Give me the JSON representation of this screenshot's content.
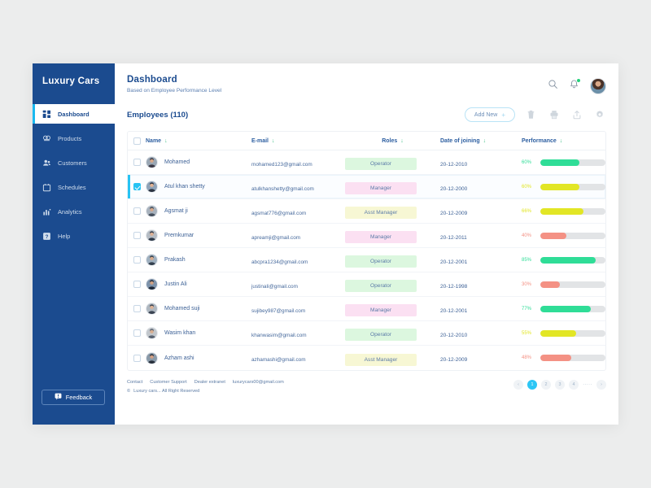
{
  "sidebar": {
    "brand": "Luxury Cars",
    "items": [
      {
        "label": "Dashboard",
        "icon": "grid-icon",
        "active": true
      },
      {
        "label": "Products",
        "icon": "products-icon",
        "active": false
      },
      {
        "label": "Customers",
        "icon": "customers-icon",
        "active": false
      },
      {
        "label": "Schedules",
        "icon": "calendar-icon",
        "active": false
      },
      {
        "label": "Analytics",
        "icon": "bar-chart-icon",
        "active": false
      },
      {
        "label": "Help",
        "icon": "help-icon",
        "active": false
      }
    ],
    "feedback_label": "Feedback",
    "bg_color": "#1b4b8f",
    "active_accent": "#19b9f0"
  },
  "header": {
    "title": "Dashboard",
    "subtitle": "Based on Employee Performance Level",
    "icons": [
      "search-icon",
      "bell-icon",
      "avatar"
    ],
    "notification_dot_color": "#24d07a"
  },
  "toolbar": {
    "section_title": "Employees (110)",
    "add_new_label": "Add New",
    "add_new_plus": "+",
    "icons": [
      "trash-icon",
      "print-icon",
      "upload-icon",
      "gear-icon"
    ]
  },
  "table": {
    "columns": [
      "Name",
      "E-mail",
      "Roles",
      "Date of joining",
      "Performance"
    ],
    "sort_glyph": "↓",
    "role_colors": {
      "Operator": "#dcf7df",
      "Manager": "#fbe0f2",
      "Asst Manager": "#f7f7d4"
    },
    "perf_colors": {
      "green": "#2fdd97",
      "yellow": "#e2e625",
      "red": "#f49184"
    },
    "track_color": "#e2e4e6",
    "rows": [
      {
        "checked": false,
        "name": "Mohamed",
        "email": "mohamed123@gmail.com",
        "role": "Operator",
        "date": "20-12-2010",
        "pct": "60%",
        "value": 60,
        "color": "green"
      },
      {
        "checked": true,
        "name": "Atul khan shetty",
        "email": "atulkhanshetty@gmail.com",
        "role": "Manager",
        "date": "20-12-2000",
        "pct": "60%",
        "value": 60,
        "color": "yellow"
      },
      {
        "checked": false,
        "name": "Agsmat ji",
        "email": "agsmat776@gmail.com",
        "role": "Asst Manager",
        "date": "20-12-2009",
        "pct": "66%",
        "value": 66,
        "color": "yellow"
      },
      {
        "checked": false,
        "name": "Premkumar",
        "email": "apreamji@gmail.com",
        "role": "Manager",
        "date": "20-12-2011",
        "pct": "40%",
        "value": 40,
        "color": "red"
      },
      {
        "checked": false,
        "name": "Prakash",
        "email": "abcpra1234@gmail.com",
        "role": "Operator",
        "date": "20-12-2001",
        "pct": "85%",
        "value": 85,
        "color": "green"
      },
      {
        "checked": false,
        "name": "Justin Ali",
        "email": "justinali@gmail.com",
        "role": "Operator",
        "date": "20-12-1998",
        "pct": "30%",
        "value": 30,
        "color": "red"
      },
      {
        "checked": false,
        "name": "Mohamed suji",
        "email": "sujibey987@gmail.com",
        "role": "Manager",
        "date": "20-12-2001",
        "pct": "77%",
        "value": 77,
        "color": "green"
      },
      {
        "checked": false,
        "name": "Wasim khan",
        "email": "khanwasim@gmail.com",
        "role": "Operator",
        "date": "20-12-2010",
        "pct": "55%",
        "value": 55,
        "color": "yellow"
      },
      {
        "checked": false,
        "name": "Azham ashi",
        "email": "azhamashi@gmail.com",
        "role": "Asst Manager",
        "date": "20-12-2009",
        "pct": "48%",
        "value": 48,
        "color": "red"
      }
    ]
  },
  "footer": {
    "links": [
      "Contact",
      "Customer Support",
      "Dealer extranet",
      "luxurycars00@gmail.com"
    ],
    "copyright": "Luxury cars...      All Right Reserved",
    "copyright_mark": "©"
  },
  "pagination": {
    "prev": "‹",
    "pages": [
      "1",
      "2",
      "3",
      "4"
    ],
    "dots": "·····",
    "next": "›",
    "active_index": 0,
    "active_color": "#2cc6f5"
  }
}
